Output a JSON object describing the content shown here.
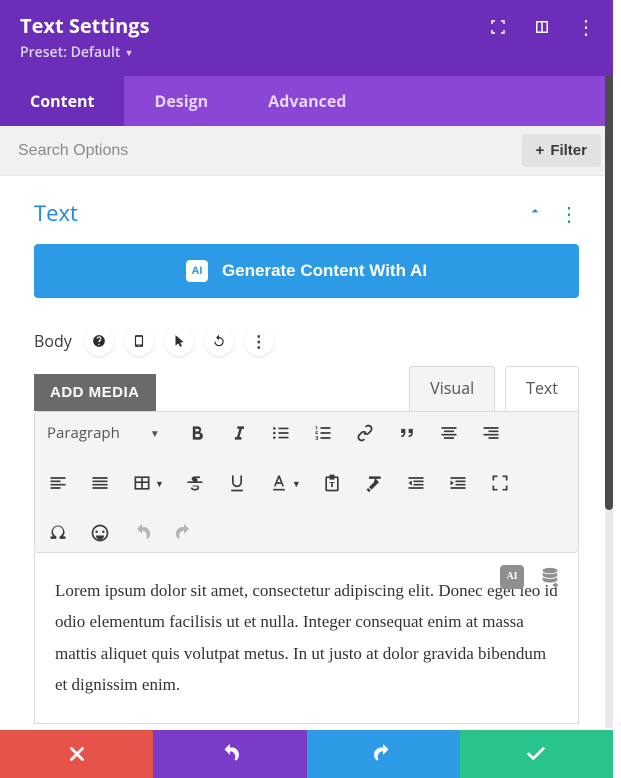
{
  "header": {
    "title": "Text Settings",
    "preset_label": "Preset: Default"
  },
  "tabs": {
    "items": [
      {
        "label": "Content",
        "active": true
      },
      {
        "label": "Design",
        "active": false
      },
      {
        "label": "Advanced",
        "active": false
      }
    ]
  },
  "search": {
    "placeholder": "Search Options",
    "filter_label": "Filter"
  },
  "section": {
    "title": "Text",
    "ai_button": "Generate Content With AI",
    "body_label": "Body",
    "add_media": "ADD MEDIA"
  },
  "editor_tabs": {
    "visual": "Visual",
    "text": "Text"
  },
  "toolbar": {
    "paragraph": "Paragraph"
  },
  "content": {
    "body": "Lorem ipsum dolor sit amet, consectetur adipiscing elit. Donec eget leo id odio elementum facilisis ut et nulla. Integer consequat enim at massa mattis aliquet quis volutpat metus. In ut justo at dolor gravida bibendum et dignissim enim."
  }
}
